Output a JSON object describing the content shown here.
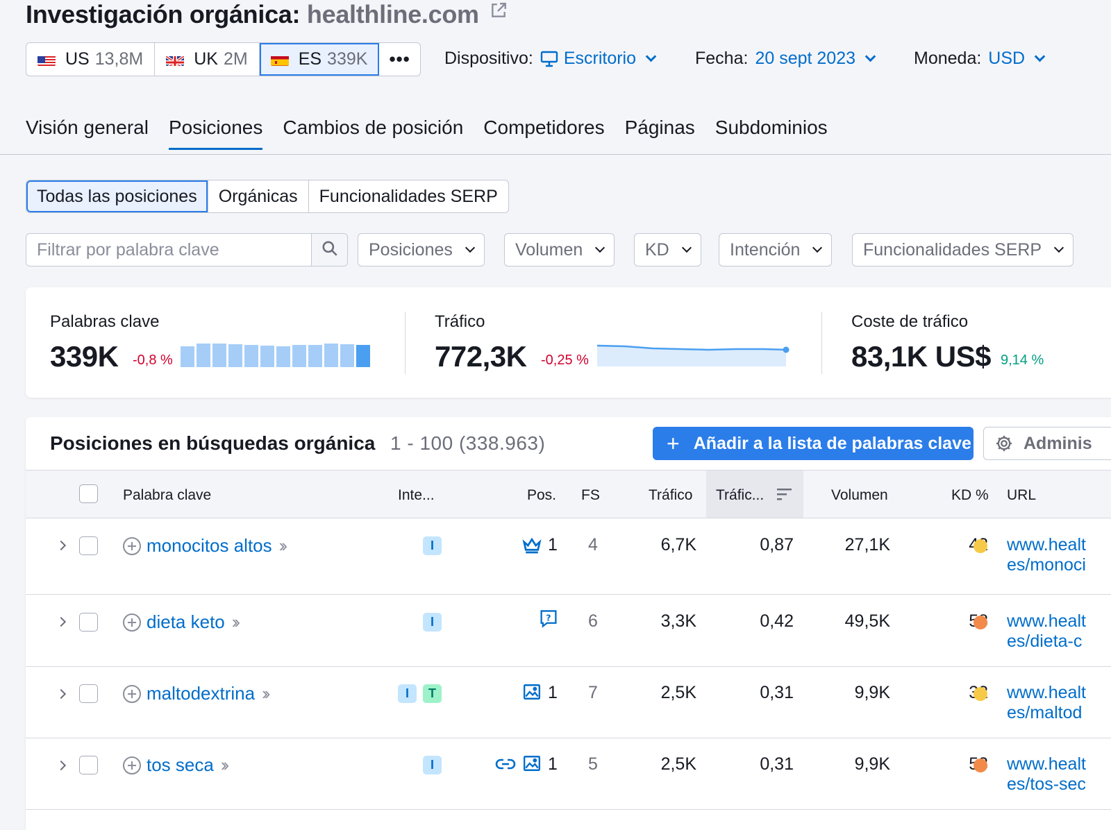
{
  "header": {
    "title_prefix": "Investigación orgánica:",
    "domain": "healthline.com"
  },
  "databases": [
    {
      "code": "US",
      "value": "13,8M",
      "flag": "us"
    },
    {
      "code": "UK",
      "value": "2M",
      "flag": "uk"
    },
    {
      "code": "ES",
      "value": "339K",
      "flag": "es",
      "active": true
    }
  ],
  "more_label": "•••",
  "filters": {
    "device_label": "Dispositivo:",
    "device_value": "Escritorio",
    "date_label": "Fecha:",
    "date_value": "20 sept 2023",
    "currency_label": "Moneda:",
    "currency_value": "USD"
  },
  "tabs": [
    "Visión general",
    "Posiciones",
    "Cambios de posición",
    "Competidores",
    "Páginas",
    "Subdominios"
  ],
  "active_tab": "Posiciones",
  "segments": [
    "Todas las posiciones",
    "Orgánicas",
    "Funcionalidades SERP"
  ],
  "search": {
    "placeholder": "Filtrar por palabra clave"
  },
  "dropdowns": [
    "Posiciones",
    "Volumen",
    "KD",
    "Intención",
    "Funcionalidades SERP"
  ],
  "summary": {
    "keywords": {
      "label": "Palabras clave",
      "value": "339K",
      "change": "-0,8 %"
    },
    "traffic": {
      "label": "Tráfico",
      "value": "772,3K",
      "change": "-0,25 %"
    },
    "cost": {
      "label": "Coste de tráfico",
      "value": "83,1K US$",
      "change": "9,14 %"
    }
  },
  "table": {
    "title": "Posiciones en búsquedas orgánica",
    "count": "1 - 100 (338.963)",
    "add_button": "Añadir a la lista de palabras clave",
    "admin_button": "Adminis",
    "columns": {
      "keyword": "Palabra clave",
      "intent": "Inte...",
      "pos": "Pos.",
      "fs": "FS",
      "traffic": "Tráfico",
      "traffic_pct": "Tráfic...",
      "volume": "Volumen",
      "kd": "KD %",
      "url": "URL"
    },
    "rows": [
      {
        "keyword": "monocitos altos",
        "intents": [
          "I"
        ],
        "serp": [
          "crown"
        ],
        "pos": "1",
        "fs": "4",
        "traffic": "6,7K",
        "traffic_pct": "0,87",
        "volume": "27,1K",
        "kd": "42",
        "kd_color": "#f7c948",
        "url1": "www.healt",
        "url2": "es/monoci"
      },
      {
        "keyword": "dieta keto",
        "intents": [
          "I"
        ],
        "serp": [
          "faq"
        ],
        "pos": "",
        "fs": "6",
        "traffic": "3,3K",
        "traffic_pct": "0,42",
        "volume": "49,5K",
        "kd": "58",
        "kd_color": "#f28a4a",
        "url1": "www.healt",
        "url2": "es/dieta-c"
      },
      {
        "keyword": "maltodextrina",
        "intents": [
          "I",
          "T"
        ],
        "serp": [
          "image"
        ],
        "pos": "1",
        "fs": "7",
        "traffic": "2,5K",
        "traffic_pct": "0,31",
        "volume": "9,9K",
        "kd": "32",
        "kd_color": "#f7c948",
        "url1": "www.healt",
        "url2": "es/maltod"
      },
      {
        "keyword": "tos seca",
        "intents": [
          "I"
        ],
        "serp": [
          "link",
          "image"
        ],
        "pos": "1",
        "fs": "5",
        "traffic": "2,5K",
        "traffic_pct": "0,31",
        "volume": "9,9K",
        "kd": "53",
        "kd_color": "#f28a4a",
        "url1": "www.healt",
        "url2": "es/tos-sec"
      }
    ]
  }
}
